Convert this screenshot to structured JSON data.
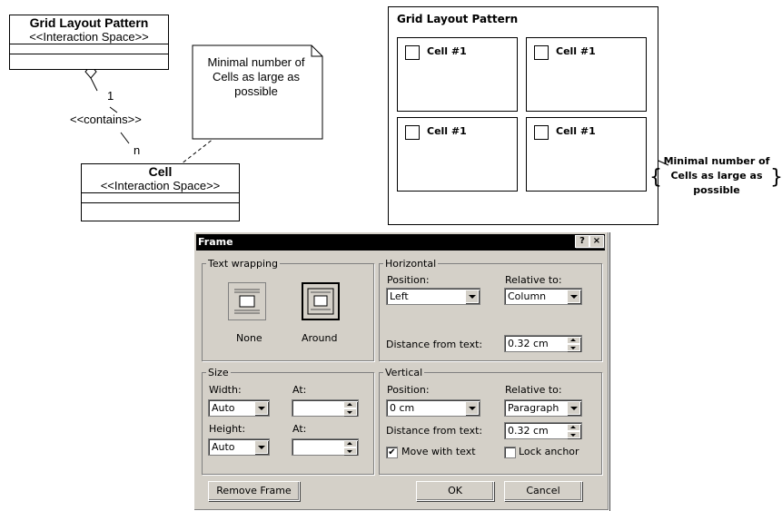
{
  "uml": {
    "class_a": {
      "name": "Grid Layout Pattern",
      "stereotype": "<<Interaction Space>>"
    },
    "class_b": {
      "name": "Cell",
      "stereotype": "<<Interaction Space>>"
    },
    "mult_one": "1",
    "mult_n": "n",
    "assoc_label": "<<contains>>",
    "note": "Minimal number of Cells as large as possible"
  },
  "mockup": {
    "title": "Grid Layout Pattern",
    "cells": [
      "Cell #1",
      "Cell #1",
      "Cell #1",
      "Cell #1"
    ],
    "note": "Minimal number of Cells as large as possible"
  },
  "dialog": {
    "title": "Frame",
    "help_button": "?",
    "close_button": "×",
    "text_wrapping": {
      "legend": "Text wrapping",
      "option_none": "None",
      "option_around": "Around"
    },
    "horizontal": {
      "legend": "Horizontal",
      "position_label": "Position:",
      "position_value": "Left",
      "relative_label": "Relative to:",
      "relative_value": "Column",
      "distance_label": "Distance from text:",
      "distance_value": "0.32 cm"
    },
    "size": {
      "legend": "Size",
      "width_label": "Width:",
      "width_value": "Auto",
      "width_at_label": "At:",
      "width_at_value": "",
      "height_label": "Height:",
      "height_value": "Auto",
      "height_at_label": "At:",
      "height_at_value": ""
    },
    "vertical": {
      "legend": "Vertical",
      "position_label": "Position:",
      "position_value": "0 cm",
      "relative_label": "Relative to:",
      "relative_value": "Paragraph",
      "distance_label": "Distance from text:",
      "distance_value": "0.32 cm",
      "move_with_text": "Move with text",
      "move_with_text_checked": "✔",
      "lock_anchor": "Lock anchor"
    },
    "buttons": {
      "remove_frame": "Remove Frame",
      "ok": "OK",
      "cancel": "Cancel"
    }
  }
}
